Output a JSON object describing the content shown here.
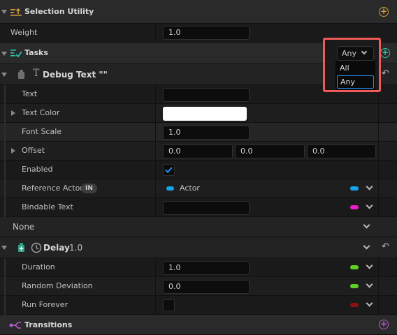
{
  "sections": {
    "selection_utility": {
      "title": "Selection Utility",
      "weight_label": "Weight",
      "weight_value": "1.0"
    },
    "tasks": {
      "title": "Tasks",
      "selector_value": "Any",
      "dropdown_options": [
        "All",
        "Any"
      ]
    },
    "debug_text": {
      "title": "Debug Text \"\"",
      "text_label": "Text",
      "text_color_label": "Text Color",
      "font_scale_label": "Font Scale",
      "font_scale_value": "1.0",
      "offset_label": "Offset",
      "offset_x": "0.0",
      "offset_y": "0.0",
      "offset_z": "0.0",
      "enabled_label": "Enabled",
      "reference_actor_label": "Reference Actor",
      "reference_actor_badge": "IN",
      "reference_actor_value": "Actor",
      "bindable_text_label": "Bindable Text"
    },
    "none_row": {
      "label": "None"
    },
    "delay": {
      "title": "Delay",
      "title_value": "1.0",
      "duration_label": "Duration",
      "duration_value": "1.0",
      "random_deviation_label": "Random Deviation",
      "random_deviation_value": "0.0",
      "run_forever_label": "Run Forever"
    },
    "transitions": {
      "title": "Transitions"
    }
  },
  "colors": {
    "accent_orange": "#d69a3a",
    "accent_teal": "#2fc4a8",
    "pin_blue": "#13a6ea",
    "pin_magenta": "#e61ec8",
    "pin_green": "#5ed024",
    "pin_red": "#8b1010",
    "highlight": "#f05a5a"
  }
}
